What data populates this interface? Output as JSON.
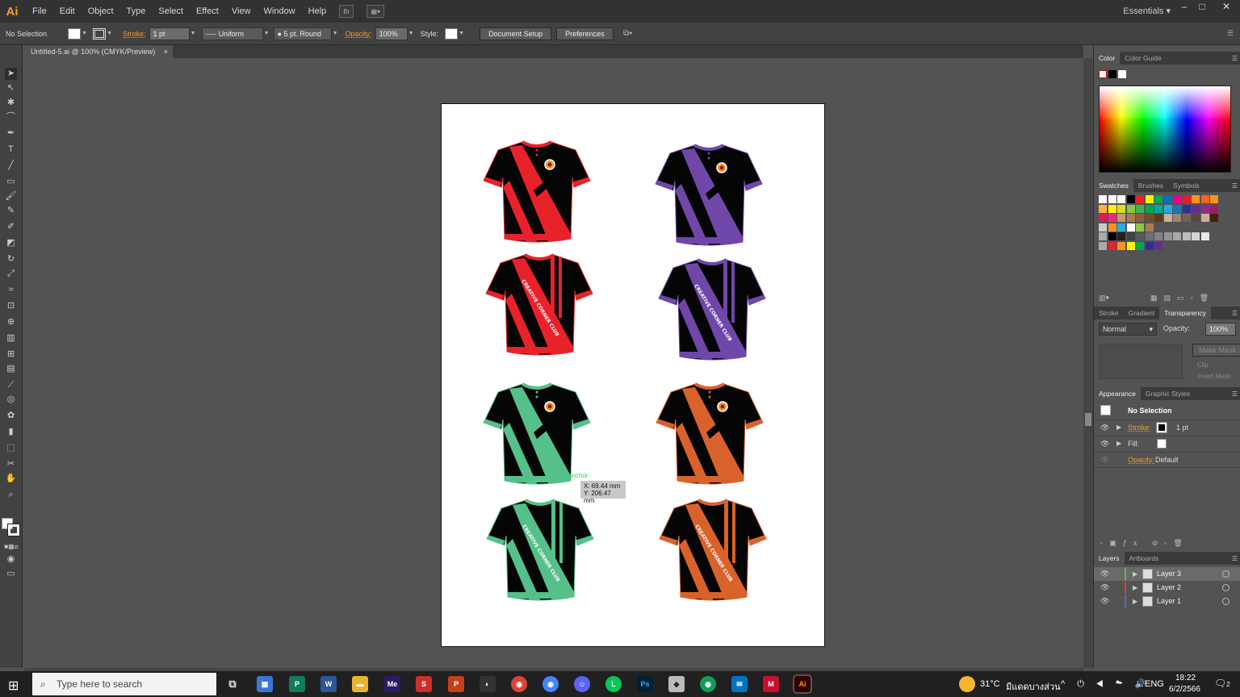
{
  "app": {
    "logo": "Ai",
    "menus": [
      "File",
      "Edit",
      "Object",
      "Type",
      "Select",
      "Effect",
      "View",
      "Window",
      "Help"
    ],
    "workspace": "Essentials"
  },
  "control": {
    "selection": "No Selection",
    "stroke_label": "Stroke:",
    "stroke_weight": "1 pt",
    "profile": "Uniform",
    "brush": "5 pt. Round",
    "opacity_label": "Opacity:",
    "opacity": "100%",
    "style_label": "Style:",
    "document_setup": "Document Setup",
    "preferences": "Preferences"
  },
  "document": {
    "tab": "Untitled-5.ai @ 100% (CMYK/Preview)"
  },
  "canvas": {
    "tooltip_x": "X: 69.44 mm",
    "tooltip_y": "Y: 206.47 mm",
    "smart_guide": "anchor",
    "shirt_text": "CREATIVE CORNER CLUB",
    "shirt_colors": [
      "#e8222a",
      "#6f47a8",
      "#55c08a",
      "#d9622c"
    ]
  },
  "panels": {
    "color_tab": "Color",
    "color_guide_tab": "Color Guide",
    "swatches_tab": "Swatches",
    "brushes_tab": "Brushes",
    "symbols_tab": "Symbols",
    "stroke_tab": "Stroke",
    "gradient_tab": "Gradient",
    "transparency_tab": "Transparency",
    "blend_mode": "Normal",
    "opacity_label": "Opacity:",
    "opacity": "100%",
    "make_mask": "Make Mask",
    "clip": "Clip",
    "invert_mask": "Invert Mask",
    "appearance_tab": "Appearance",
    "graphic_styles_tab": "Graphic Styles",
    "appearance_title": "No Selection",
    "stroke_label": "Stroke:",
    "stroke_value": "1 pt",
    "fill_label": "Fill:",
    "opacity_row_label": "Opacity:",
    "opacity_row_value": "Default",
    "layers_tab": "Layers",
    "artboards_tab": "Artboards",
    "layers": [
      {
        "name": "Layer 3",
        "color": "#4fbf4f"
      },
      {
        "name": "Layer 2",
        "color": "#e04040"
      },
      {
        "name": "Layer 1",
        "color": "#4a6ee0"
      }
    ]
  },
  "taskbar": {
    "search": "Type here to search",
    "weather": "31°C",
    "weather_desc": "มีแดดบางส่วน",
    "lang": "ENG",
    "time": "18:22",
    "date": "6/2/2566",
    "notif": "2"
  }
}
